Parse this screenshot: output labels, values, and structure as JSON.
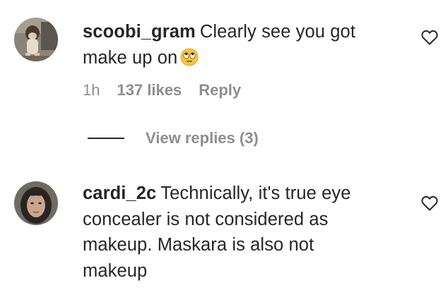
{
  "comments": [
    {
      "username": "scoobi_gram",
      "text_line1": "Clearly see you got",
      "text_line2": "make up on",
      "emoji_icon": "face-with-rolling-eyes-icon",
      "time": "1h",
      "likes": "137 likes",
      "reply_label": "Reply",
      "view_replies": "View replies (3)"
    },
    {
      "username": "cardi_2c",
      "text_line1": "Technically, it's true eye",
      "text_line2": "concealer is not considered as",
      "text_line3": "makeup. Maskara is also not",
      "text_line4": "makeup"
    }
  ],
  "colors": {
    "text": "#262626",
    "secondary": "#8e8e8e",
    "background": "#ffffff"
  }
}
